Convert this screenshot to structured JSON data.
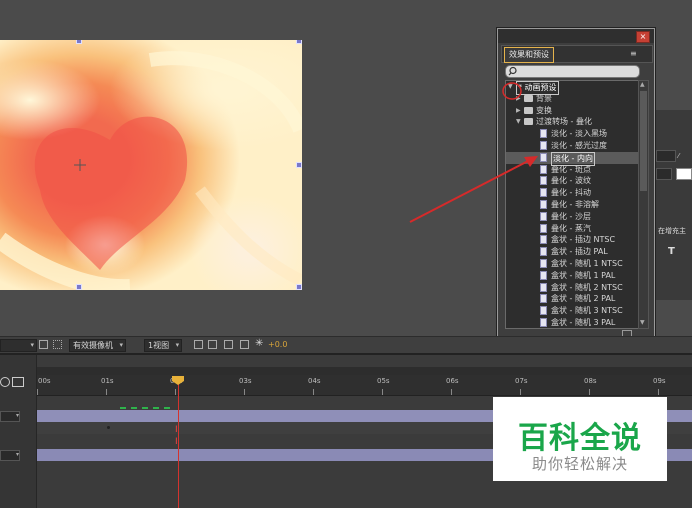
{
  "viewer": {
    "toolbar": {
      "zoom_prefix": "",
      "camera_select": "有效摄像机",
      "view_select": "1视图",
      "exposure_value": "+0.0"
    }
  },
  "timeline": {
    "ruler_labels": [
      "00s",
      "01s",
      "02s",
      "03s",
      "04s",
      "05s",
      "06s",
      "07s",
      "08s",
      "09s"
    ],
    "current_time_marker": "02s"
  },
  "effects_panel": {
    "tab_label": "效果和预设",
    "close_icon": "×",
    "menu_icon": "≡",
    "search_placeholder": "",
    "tree": [
      {
        "label": "* 动画预设",
        "level": 0,
        "expanded": true,
        "type": "folder",
        "boxed": true
      },
      {
        "label": "背景",
        "level": 1,
        "expanded": false,
        "type": "folder"
      },
      {
        "label": "变换",
        "level": 1,
        "expanded": false,
        "type": "folder"
      },
      {
        "label": "过渡转场 - 叠化",
        "level": 1,
        "expanded": true,
        "type": "folder"
      },
      {
        "label": "淡化 - 淡入黑场",
        "level": 2,
        "type": "preset"
      },
      {
        "label": "淡化 - 感光过度",
        "level": 2,
        "type": "preset"
      },
      {
        "label": "淡化 - 内向",
        "level": 2,
        "type": "preset",
        "selected": true
      },
      {
        "label": "叠化 - 斑点",
        "level": 2,
        "type": "preset"
      },
      {
        "label": "叠化 - 波纹",
        "level": 2,
        "type": "preset"
      },
      {
        "label": "叠化 - 抖动",
        "level": 2,
        "type": "preset"
      },
      {
        "label": "叠化 - 非溶解",
        "level": 2,
        "type": "preset"
      },
      {
        "label": "叠化 - 沙层",
        "level": 2,
        "type": "preset"
      },
      {
        "label": "叠化 - 蒸汽",
        "level": 2,
        "type": "preset"
      },
      {
        "label": "盒状 - 插边 NTSC",
        "level": 2,
        "type": "preset"
      },
      {
        "label": "盒状 - 插边 PAL",
        "level": 2,
        "type": "preset"
      },
      {
        "label": "盒状 - 随机 1 NTSC",
        "level": 2,
        "type": "preset"
      },
      {
        "label": "盒状 - 随机 1 PAL",
        "level": 2,
        "type": "preset"
      },
      {
        "label": "盒状 - 随机 2 NTSC",
        "level": 2,
        "type": "preset"
      },
      {
        "label": "盒状 - 随机 2 PAL",
        "level": 2,
        "type": "preset"
      },
      {
        "label": "盒状 - 随机 3 NTSC",
        "level": 2,
        "type": "preset"
      },
      {
        "label": "盒状 - 随机 3 PAL",
        "level": 2,
        "type": "preset"
      }
    ]
  },
  "right_panel": {
    "snippet": "在增充主"
  },
  "watermark": {
    "title": "百科全说",
    "subtitle": "助你轻松解决"
  },
  "colors": {
    "accent_annotation": "#d62a2a",
    "watermark_green": "#1aa64a",
    "tab_highlight": "#e5b34c"
  }
}
